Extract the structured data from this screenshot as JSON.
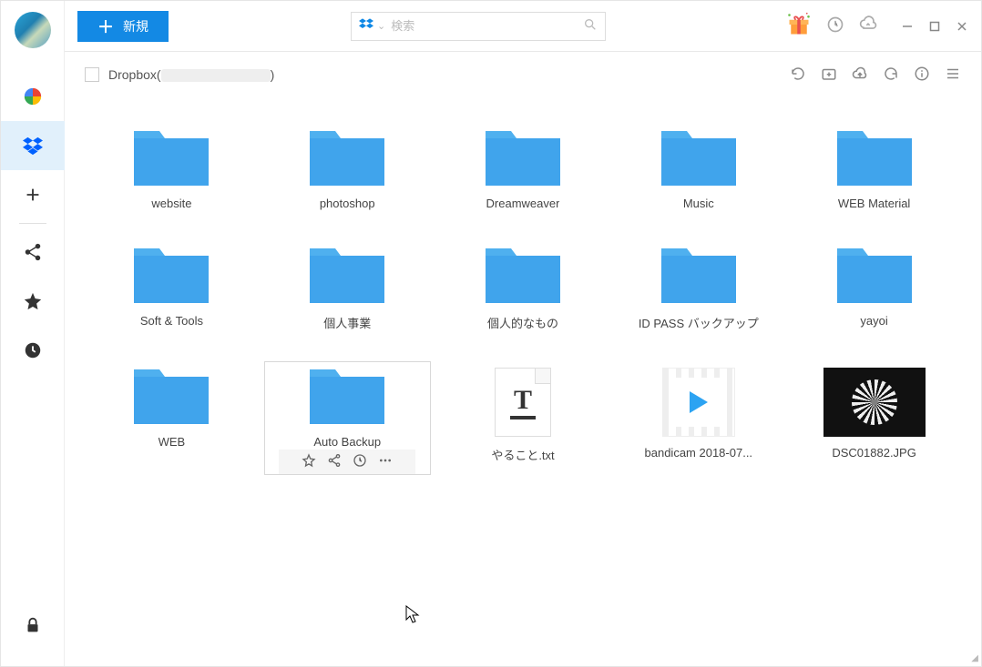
{
  "sidebar": {
    "items": [
      "photos",
      "dropbox",
      "add",
      "share",
      "favorites",
      "recent"
    ],
    "bottom": "lock"
  },
  "topbar": {
    "new_label": "新規",
    "search_placeholder": "検索"
  },
  "breadcrumb": {
    "service": "Dropbox",
    "account_redacted": true
  },
  "items": [
    {
      "type": "folder",
      "label": "website"
    },
    {
      "type": "folder",
      "label": "photoshop"
    },
    {
      "type": "folder",
      "label": "Dreamweaver"
    },
    {
      "type": "folder",
      "label": "Music"
    },
    {
      "type": "folder",
      "label": "WEB Material"
    },
    {
      "type": "folder",
      "label": "Soft & Tools"
    },
    {
      "type": "folder",
      "label": "個人事業"
    },
    {
      "type": "folder",
      "label": "個人的なもの"
    },
    {
      "type": "folder",
      "label": "ID PASS バックアップ"
    },
    {
      "type": "folder",
      "label": "yayoi"
    },
    {
      "type": "folder",
      "label": "WEB"
    },
    {
      "type": "folder",
      "label": "Auto Backup",
      "selected": true
    },
    {
      "type": "text",
      "label": "やること.txt"
    },
    {
      "type": "video",
      "label": "bandicam 2018-07..."
    },
    {
      "type": "image",
      "label": "DSC01882.JPG"
    }
  ]
}
